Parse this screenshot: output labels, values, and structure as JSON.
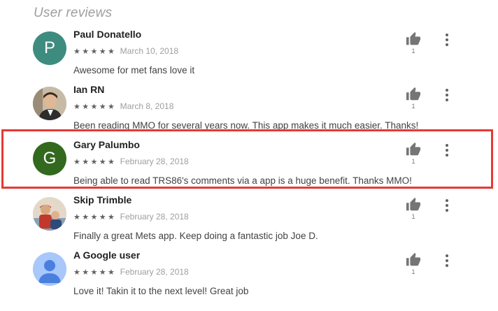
{
  "section_title": "User reviews",
  "colors": {
    "highlight": "#e53935",
    "star": "#616161"
  },
  "reviews": [
    {
      "name": "Paul Donatello",
      "avatar_letter": "P",
      "avatar_color": "#3e8c7f",
      "stars": "★★★★★",
      "rating": 5,
      "date": "March 10, 2018",
      "text": "Awesome for met fans love it",
      "likes": "1"
    },
    {
      "name": "Ian RN",
      "avatar_letter": "",
      "avatar_color": "#b7a995",
      "stars": "★★★★★",
      "rating": 5,
      "date": "March 8, 2018",
      "text": "Been reading MMO for several years now. This app makes it much easier. Thanks!",
      "likes": "1"
    },
    {
      "name": "Gary Palumbo",
      "avatar_letter": "G",
      "avatar_color": "#33691e",
      "stars": "★★★★★",
      "rating": 5,
      "date": "February 28, 2018",
      "text": "Being able to read TRS86's comments via a app is a huge benefit. Thanks MMO!",
      "likes": "1"
    },
    {
      "name": "Skip Trimble",
      "avatar_letter": "",
      "avatar_color": "#d7c9b8",
      "stars": "★★★★★",
      "rating": 5,
      "date": "February 28, 2018",
      "text": "Finally a great Mets app. Keep doing a fantastic job Joe D.",
      "likes": "1"
    },
    {
      "name": "A Google user",
      "avatar_letter": "",
      "avatar_color": "#a8c7fa",
      "stars": "★★★★★",
      "rating": 5,
      "date": "February 28, 2018",
      "text": "Love it! Takin it to the next level! Great job",
      "likes": "1"
    }
  ],
  "icons": {
    "like": "thumb-up-icon",
    "more": "more-vert-icon"
  }
}
